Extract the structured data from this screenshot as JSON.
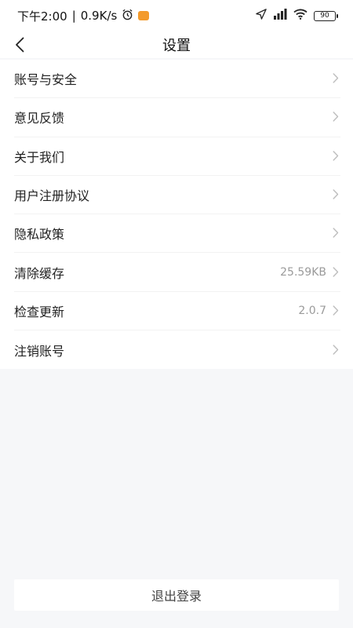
{
  "status_bar": {
    "time": "下午2:00",
    "net_speed": "0.9K/s",
    "battery": "90"
  },
  "nav": {
    "title": "设置"
  },
  "menu": [
    {
      "label": "账号与安全",
      "value": ""
    },
    {
      "label": "意见反馈",
      "value": ""
    },
    {
      "label": "关于我们",
      "value": ""
    },
    {
      "label": "用户注册协议",
      "value": ""
    },
    {
      "label": "隐私政策",
      "value": ""
    },
    {
      "label": "清除缓存",
      "value": "25.59KB"
    },
    {
      "label": "检查更新",
      "value": "2.0.7"
    },
    {
      "label": "注销账号",
      "value": ""
    }
  ],
  "logout": {
    "label": "退出登录"
  },
  "icons": {
    "back": "back-arrow-icon",
    "chevron": "chevron-right-icon",
    "alarm": "alarm-clock-icon",
    "location": "location-arrow-icon",
    "signal": "signal-icon",
    "wifi": "wifi-icon",
    "battery": "battery-icon"
  },
  "colors": {
    "background": "#f6f7f9",
    "card": "#ffffff",
    "text": "#222222",
    "secondary": "#9a9a9a",
    "divider": "#f2f2f2",
    "badge": "#f39a2b"
  }
}
